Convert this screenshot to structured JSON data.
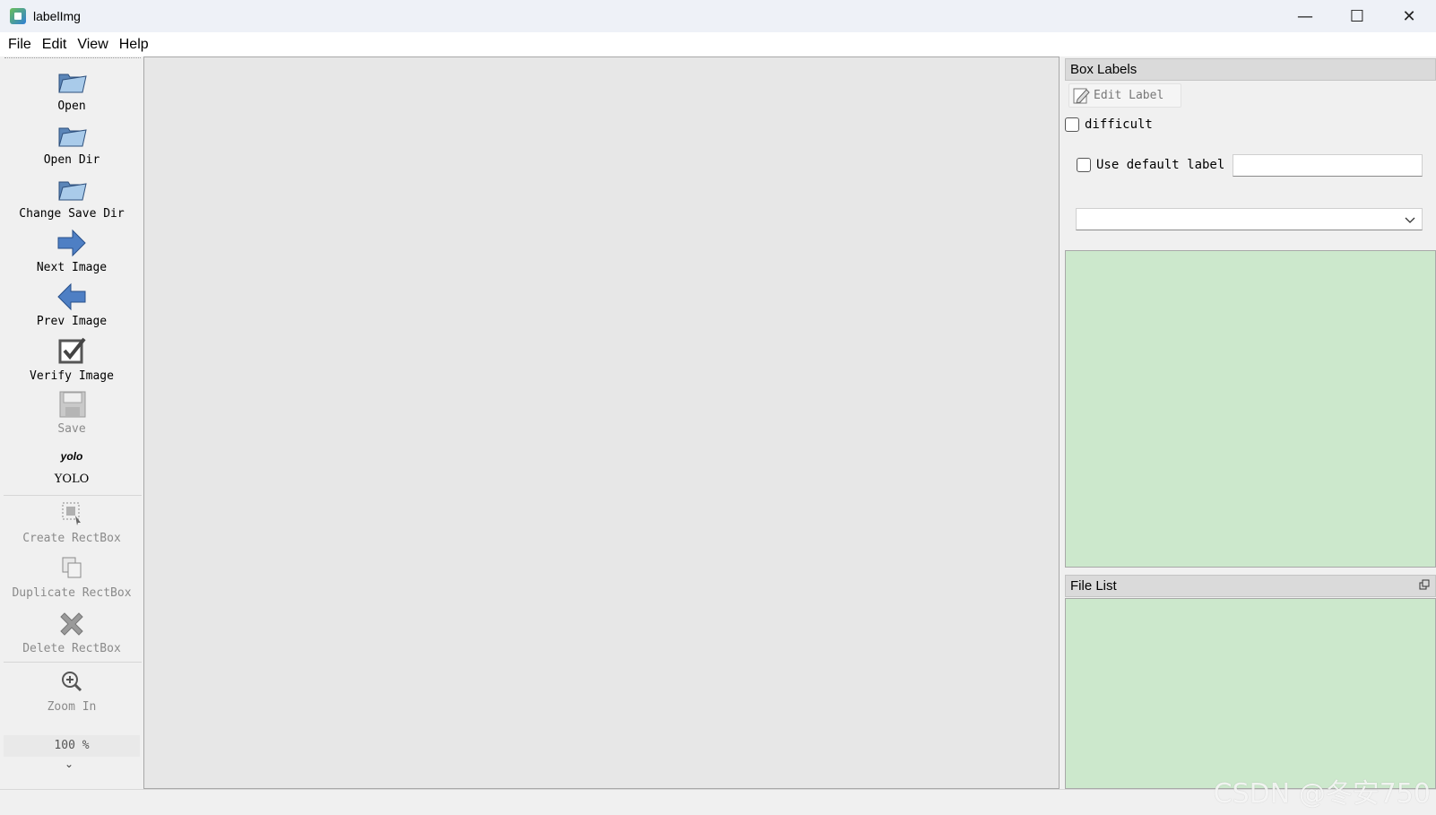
{
  "window": {
    "title": "labelImg",
    "controls": {
      "minimize": "—",
      "maximize": "☐",
      "close": "✕"
    }
  },
  "menu": [
    "File",
    "Edit",
    "View",
    "Help"
  ],
  "toolbar": {
    "open": "Open",
    "open_dir": "Open Dir",
    "change_save_dir": "Change Save Dir",
    "next_image": "Next Image",
    "prev_image": "Prev Image",
    "verify_image": "Verify Image",
    "save": "Save",
    "format_icon_text": "yolo",
    "format": "YOLO",
    "create_rectbox": "Create RectBox",
    "duplicate_rectbox": "Duplicate RectBox",
    "delete_rectbox": "Delete RectBox",
    "zoom_in": "Zoom In",
    "zoom_value": "100 %",
    "more": "»"
  },
  "box_labels": {
    "title": "Box Labels",
    "edit_label": "Edit Label",
    "difficult": "difficult",
    "use_default_label": "Use default label",
    "default_label_value": "",
    "combo_value": ""
  },
  "file_list": {
    "title": "File List"
  },
  "statusbar": {
    "text": ""
  },
  "watermark": "CSDN @冬安750",
  "colors": {
    "list_bg": "#cce8cc",
    "canvas_bg": "#e7e7e7",
    "titlebar_bg": "#eef1f7"
  }
}
